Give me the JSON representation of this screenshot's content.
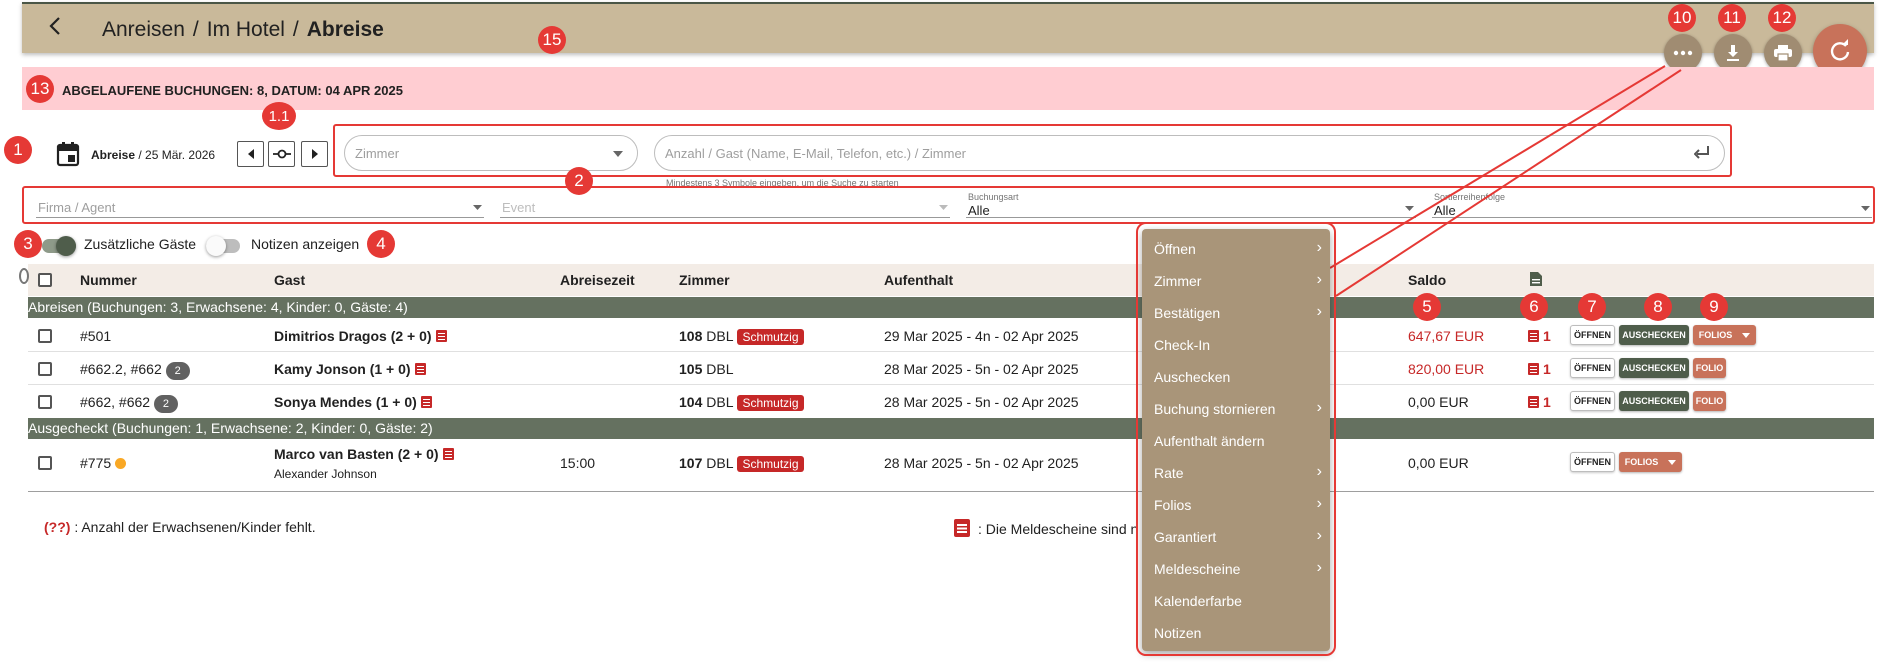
{
  "breadcrumb": {
    "part1": "Anreisen",
    "part2": "Im Hotel",
    "current": "Abreise",
    "sep": "/"
  },
  "warning": {
    "text": "ABGELAUFENE BUCHUNGEN: 8, DATUM: 04 APR 2025"
  },
  "date_filter": {
    "label": "Abreise",
    "date": "/ 25 Mär. 2026"
  },
  "room_select": {
    "placeholder": "Zimmer"
  },
  "search": {
    "placeholder": "Anzahl / Gast (Name, E-Mail, Telefon, etc.) / Zimmer",
    "hint": "Mindestens 3 Symbole eingeben, um die Suche zu starten"
  },
  "filters": {
    "company": {
      "placeholder": "Firma / Agent"
    },
    "event": {
      "placeholder": "Event"
    },
    "booking_type": {
      "label": "Buchungsart",
      "value": "Alle"
    },
    "sort": {
      "label": "Sortierreihenfolge",
      "value": "Alle"
    }
  },
  "toggles": {
    "extra_guests": "Zusätzliche Gäste",
    "show_notes": "Notizen anzeigen"
  },
  "table": {
    "headers": {
      "number": "Nummer",
      "guest": "Gast",
      "departure_time": "Abreisezeit",
      "room": "Zimmer",
      "stay": "Aufenthalt",
      "saldo": "Saldo"
    },
    "group1": "Abreisen (Buchungen: 3, Erwachsene: 4, Kinder: 0, Gäste: 4)",
    "group2": "Ausgecheckt (Buchungen: 1, Erwachsene: 2, Kinder: 0, Gäste: 2)",
    "rows": [
      {
        "number": "#501",
        "count_badge": "",
        "guest": "Dimitrios Dragos (2 + 0)",
        "guest2": "",
        "time": "",
        "room_no": "108",
        "room_type": "DBL",
        "status": "Schmutzig",
        "stay": "29 Mar 2025 - 4n - 02 Apr 2025",
        "saldo": "647,67 EUR",
        "docs": "1",
        "open": "ÖFFNEN",
        "checkout": "AUSCHECKEN",
        "folio": "FOLIOS"
      },
      {
        "number": "#662.2, #662",
        "count_badge": "2",
        "guest": "Kamy Jonson (1 + 0)",
        "guest2": "",
        "time": "",
        "room_no": "105",
        "room_type": "DBL",
        "status": "",
        "stay": "28 Mar 2025 - 5n - 02 Apr 2025",
        "saldo": "820,00 EUR",
        "docs": "1",
        "open": "ÖFFNEN",
        "checkout": "AUSCHECKEN",
        "folio": "FOLIO"
      },
      {
        "number": "#662, #662",
        "count_badge": "2",
        "guest": "Sonya Mendes (1 + 0)",
        "guest2": "",
        "time": "",
        "room_no": "104",
        "room_type": "DBL",
        "status": "Schmutzig",
        "stay": "28 Mar 2025 - 5n - 02 Apr 2025",
        "saldo": "0,00 EUR",
        "docs": "1",
        "open": "ÖFFNEN",
        "checkout": "AUSCHECKEN",
        "folio": "FOLIO"
      },
      {
        "number": "#775",
        "count_badge": "",
        "guest": "Marco van Basten (2 + 0)",
        "guest2": "Alexander Johnson",
        "time": "15:00",
        "room_no": "107",
        "room_type": "DBL",
        "status": "Schmutzig",
        "stay": "28 Mar 2025 - 5n - 02 Apr 2025",
        "saldo": "0,00 EUR",
        "docs": "",
        "open": "ÖFFNEN",
        "checkout": "",
        "folio": "FOLIOS"
      }
    ]
  },
  "legend": {
    "missing_marker": "(??)",
    "missing_text": ": Anzahl der Erwachsenen/Kinder fehlt.",
    "docs_text": ": Die Meldescheine sind n"
  },
  "context_menu": {
    "items": [
      "Öffnen",
      "Zimmer",
      "Bestätigen",
      "Check-In",
      "Auschecken",
      "Buchung stornieren",
      "Aufenthalt ändern",
      "Rate",
      "Folios",
      "Garantiert",
      "Meldescheine",
      "Kalenderfarbe",
      "Notizen"
    ]
  },
  "annotations": [
    "1",
    "1.1",
    "2",
    "3",
    "4",
    "5",
    "6",
    "7",
    "8",
    "9",
    "10",
    "11",
    "12",
    "13",
    "15"
  ],
  "colors": {
    "topbar": "#c9b99a",
    "accent": "#c8725a",
    "group_row": "#657160",
    "warning_bg": "#ffcdd2",
    "badge": "#e53935"
  }
}
